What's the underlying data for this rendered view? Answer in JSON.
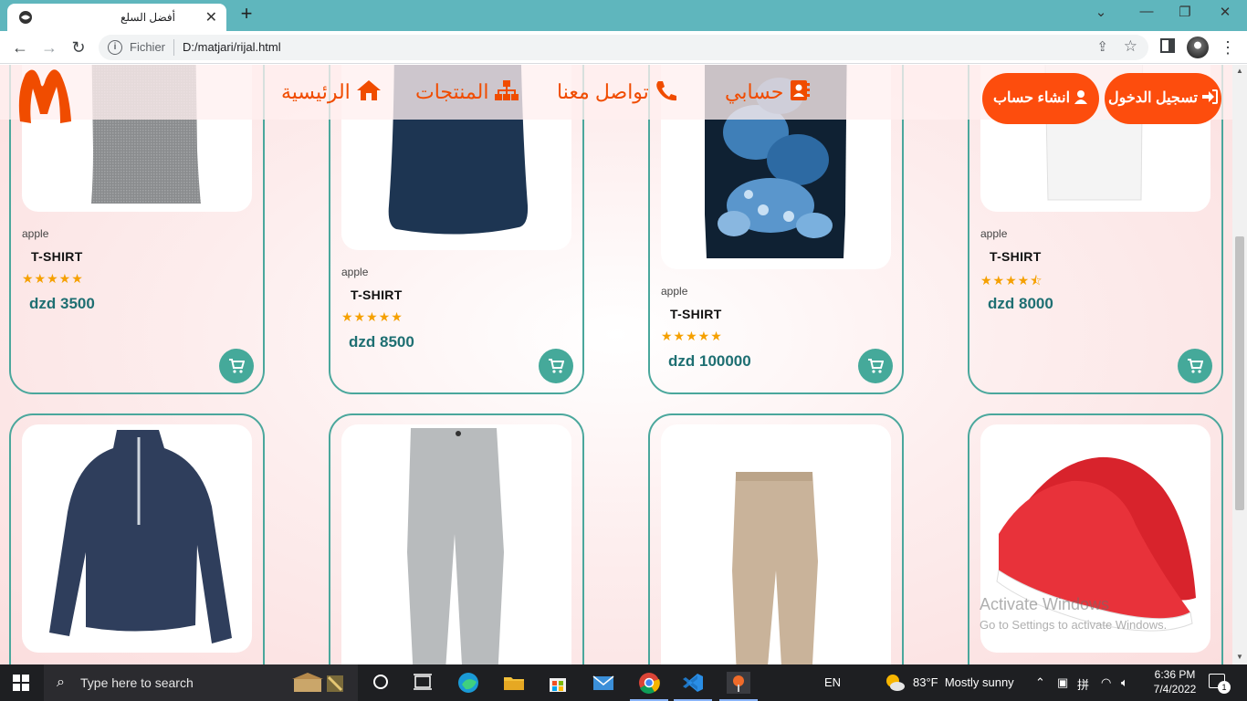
{
  "browser": {
    "tab_title": "أفضل السلع",
    "tab_close": "✕",
    "new_tab": "+",
    "address_scheme": "Fichier",
    "address_url": "D:/matjari/rijal.html",
    "window_controls": {
      "dropdown": "⌄",
      "minimize": "—",
      "maximize": "❐",
      "close": "✕"
    }
  },
  "header": {
    "nav": {
      "home": "الرئيسية",
      "products": "المنتجات",
      "contact": "تواصل معنا",
      "account": "حسابي"
    },
    "buttons": {
      "create_account": "انشاء حساب",
      "login": "تسجيل الدخول"
    }
  },
  "products": [
    {
      "brand": "apple",
      "name": "T-SHIRT",
      "stars": "★★★★★",
      "price": "dzd 3500"
    },
    {
      "brand": "apple",
      "name": "T-SHIRT",
      "stars": "★★★★★",
      "price": "dzd 8500"
    },
    {
      "brand": "apple",
      "name": "T-SHIRT",
      "stars": "★★★★★",
      "price": "dzd 100000"
    },
    {
      "brand": "apple",
      "name": "T-SHIRT",
      "stars": "★★★★⯪",
      "price": "dzd 8000"
    }
  ],
  "rating_values": [
    5,
    5,
    5,
    4.5
  ],
  "watermark": {
    "line1": "Activate Windows",
    "line2": "Go to Settings to activate Windows."
  },
  "taskbar": {
    "search_placeholder": "Type here to search",
    "language": "EN",
    "weather": "83°F  Mostly sunny",
    "time": "6:36 PM",
    "date": "7/4/2022",
    "notification_count": "1"
  },
  "colors": {
    "accent": "#fd4d0d",
    "nav_text": "#f04c00",
    "card_border": "#4aa79c",
    "price": "#1e6f72",
    "cart_button": "#45a99a",
    "star": "#f5a000",
    "tabbar": "#5fb6bd"
  }
}
